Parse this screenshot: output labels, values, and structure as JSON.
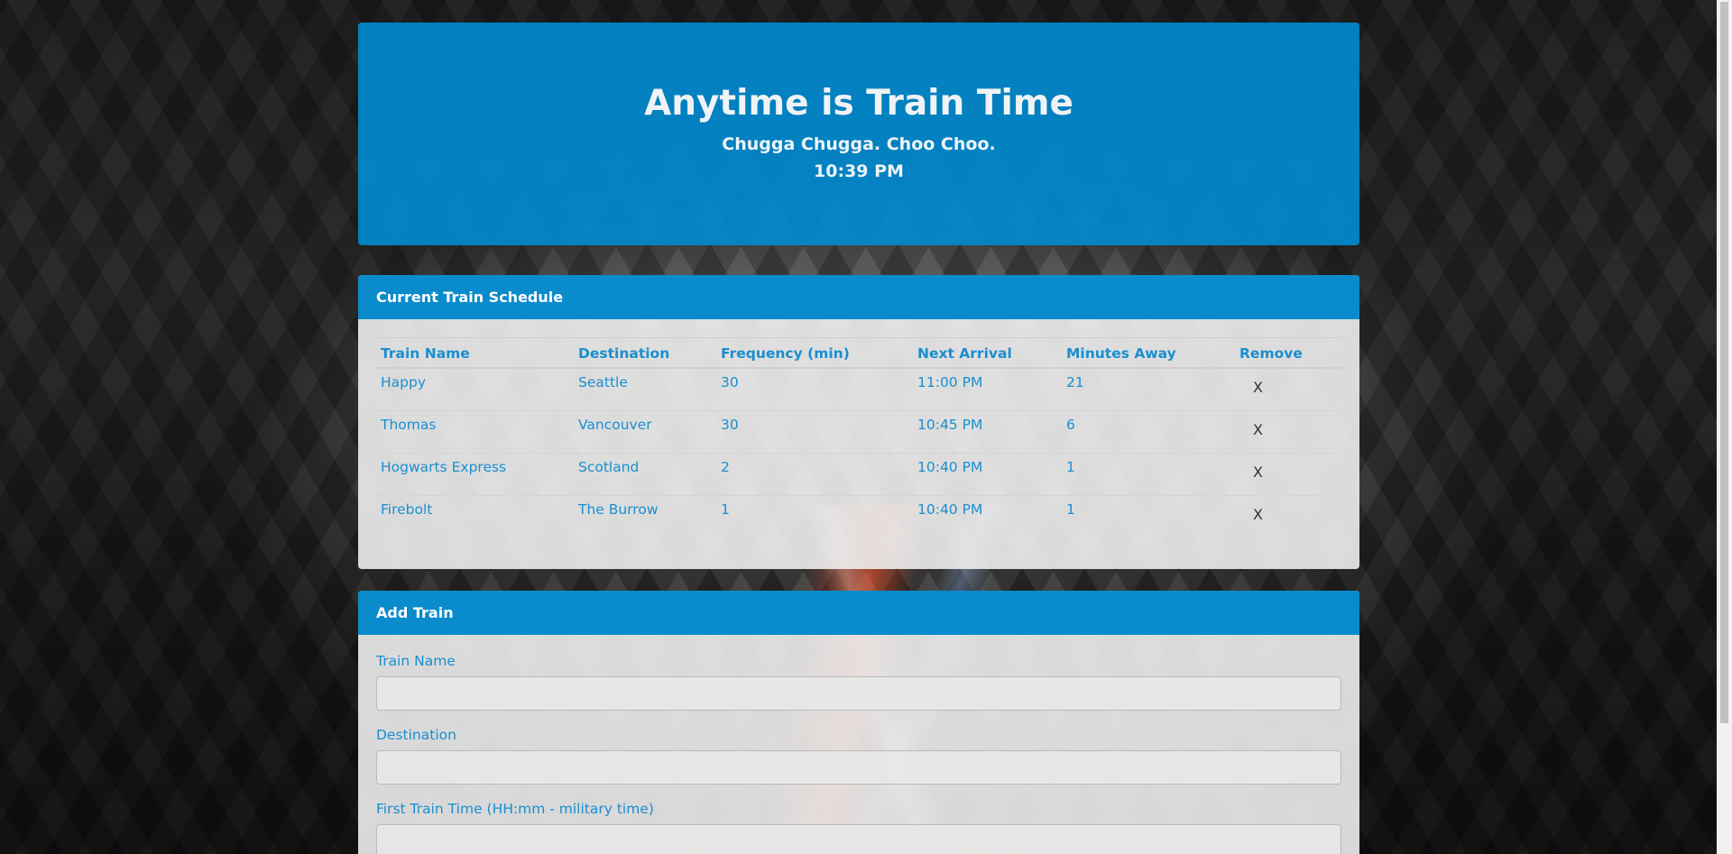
{
  "header": {
    "title": "Anytime is Train Time",
    "subtitle": "Chugga Chugga. Choo Choo.",
    "time": "10:39 PM"
  },
  "schedule": {
    "panel_title": "Current Train Schedule",
    "columns": [
      "Train Name",
      "Destination",
      "Frequency (min)",
      "Next Arrival",
      "Minutes Away",
      "Remove"
    ],
    "rows": [
      {
        "name": "Happy",
        "destination": "Seattle",
        "frequency": "30",
        "next_arrival": "11:00 PM",
        "minutes_away": "21",
        "remove": "X"
      },
      {
        "name": "Thomas",
        "destination": "Vancouver",
        "frequency": "30",
        "next_arrival": "10:45 PM",
        "minutes_away": "6",
        "remove": "X"
      },
      {
        "name": "Hogwarts Express",
        "destination": "Scotland",
        "frequency": "2",
        "next_arrival": "10:40 PM",
        "minutes_away": "1",
        "remove": "X"
      },
      {
        "name": "Firebolt",
        "destination": "The Burrow",
        "frequency": "1",
        "next_arrival": "10:40 PM",
        "minutes_away": "1",
        "remove": "X"
      }
    ]
  },
  "add_train": {
    "panel_title": "Add Train",
    "fields": [
      {
        "label": "Train Name",
        "value": ""
      },
      {
        "label": "Destination",
        "value": ""
      },
      {
        "label": "First Train Time (HH:mm - military time)",
        "value": ""
      }
    ]
  },
  "colors": {
    "accent": "#0a8ccc",
    "link_text": "#1a8ed0"
  }
}
